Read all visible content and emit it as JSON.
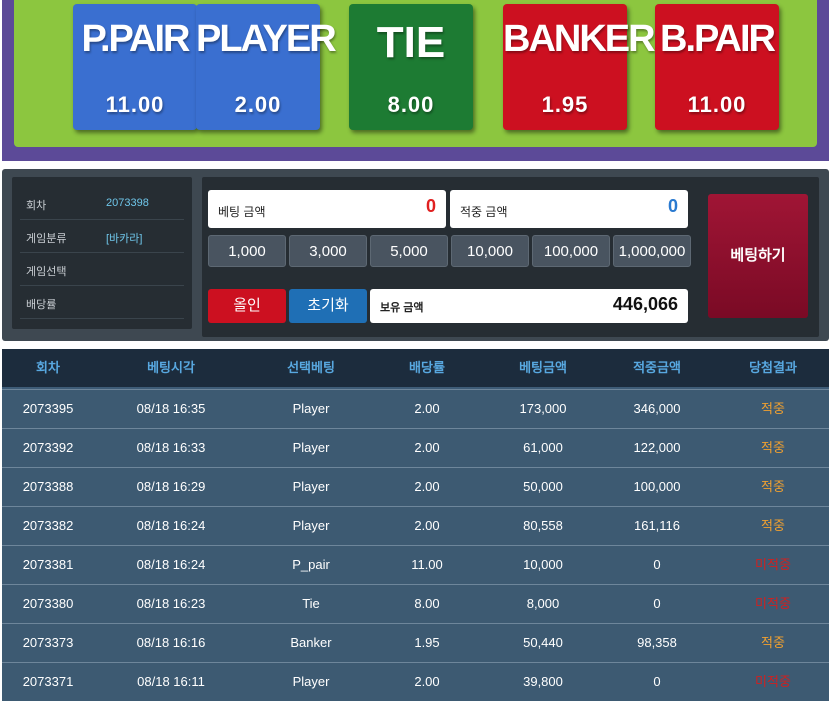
{
  "board": {
    "cards": [
      {
        "name": "P.PAIR",
        "odds": "11.00",
        "color": "#3a6fd0"
      },
      {
        "name": "PLAYER",
        "odds": "2.00",
        "color": "#3a6fd0"
      },
      {
        "name": "TIE",
        "odds": "8.00",
        "color": "#1d7b33"
      },
      {
        "name": "BANKER",
        "odds": "1.95",
        "color": "#cc1020"
      },
      {
        "name": "B.PAIR",
        "odds": "11.00",
        "color": "#cc1020"
      }
    ]
  },
  "info": {
    "round_label": "회차",
    "round_value": "2073398",
    "category_label": "게임분류",
    "category_value": "[바카라]",
    "select_label": "게임선택",
    "select_value": "",
    "rate_label": "배당률",
    "rate_value": ""
  },
  "betting": {
    "bet_amount_label": "베팅 금액",
    "bet_amount_value": "0",
    "win_amount_label": "적중 금액",
    "win_amount_value": "0",
    "chips": [
      "1,000",
      "3,000",
      "5,000",
      "10,000",
      "100,000",
      "1,000,000"
    ],
    "allin_label": "올인",
    "reset_label": "초기화",
    "balance_label": "보유 금액",
    "balance_value": "446,066",
    "submit_label": "베팅하기"
  },
  "history": {
    "headers": [
      "회차",
      "베팅시각",
      "선택베팅",
      "배당률",
      "베팅금액",
      "적중금액",
      "당첨결과"
    ],
    "rows": [
      [
        "2073395",
        "08/18 16:35",
        "Player",
        "2.00",
        "173,000",
        "346,000",
        "적중"
      ],
      [
        "2073392",
        "08/18 16:33",
        "Player",
        "2.00",
        "61,000",
        "122,000",
        "적중"
      ],
      [
        "2073388",
        "08/18 16:29",
        "Player",
        "2.00",
        "50,000",
        "100,000",
        "적중"
      ],
      [
        "2073382",
        "08/18 16:24",
        "Player",
        "2.00",
        "80,558",
        "161,116",
        "적중"
      ],
      [
        "2073381",
        "08/18 16:24",
        "P_pair",
        "11.00",
        "10,000",
        "0",
        "미적중"
      ],
      [
        "2073380",
        "08/18 16:23",
        "Tie",
        "8.00",
        "8,000",
        "0",
        "미적중"
      ],
      [
        "2073373",
        "08/18 16:16",
        "Banker",
        "1.95",
        "50,440",
        "98,358",
        "적중"
      ],
      [
        "2073371",
        "08/18 16:11",
        "Player",
        "2.00",
        "39,800",
        "0",
        "미적중"
      ]
    ],
    "win_color": "#f0a030",
    "lose_color": "#d02020",
    "header_color": "#58a8e0"
  }
}
